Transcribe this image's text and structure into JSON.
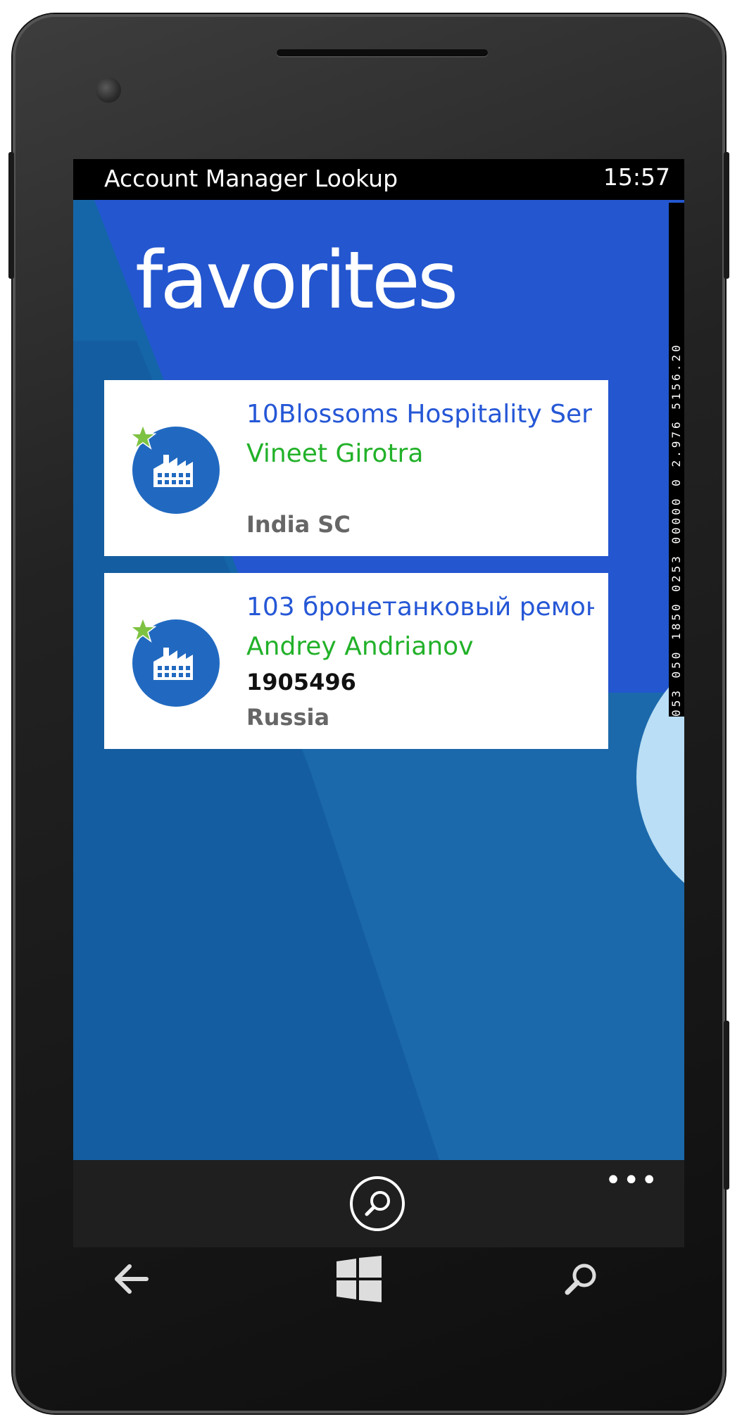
{
  "status_bar": {
    "app_title": "Account Manager Lookup",
    "time": "15:57"
  },
  "page": {
    "title": "favorites"
  },
  "debug_overlay": {
    "text": "053 050 1850 0253 00000 0 2.976 5156.20"
  },
  "favorites": [
    {
      "account": " 10Blossoms Hospitality Ser",
      "manager": "Vineet Girotra",
      "id": "",
      "region": "India SC",
      "icon": "factory-icon",
      "favorite": true
    },
    {
      "account": "103 бронетанковый ремон",
      "manager": "Andrey Andrianov",
      "id": "1905496",
      "region": "Russia",
      "icon": "factory-icon",
      "favorite": true
    }
  ],
  "app_bar": {
    "search_icon": "search-icon",
    "more_label": "•••"
  },
  "hardware_buttons": [
    "back-icon",
    "windows-icon",
    "search-icon"
  ],
  "colors": {
    "accent_blue": "#2356cf",
    "manager_green": "#22b129",
    "account_blue": "#2557d6",
    "avatar_blue": "#2169c0",
    "star_green": "#7ec242"
  }
}
